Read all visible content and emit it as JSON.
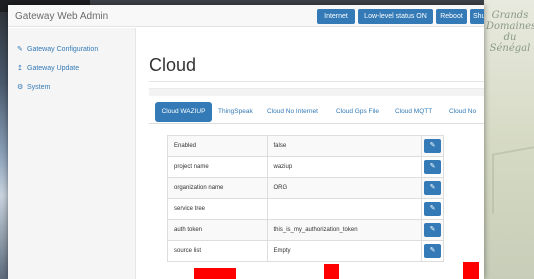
{
  "app": {
    "brand": "Gateway Web Admin"
  },
  "header_buttons": {
    "internet": "Internet",
    "lowlevel": "Low-level status ON",
    "reboot": "Reboot",
    "shutdown": "Shut"
  },
  "sidebar": {
    "items": [
      {
        "label": "Gateway Configuration",
        "icon": "edit-icon"
      },
      {
        "label": "Gateway Update",
        "icon": "upload-icon"
      },
      {
        "label": "System",
        "icon": "cogs-icon"
      }
    ]
  },
  "page": {
    "title": "Cloud"
  },
  "tabs": [
    {
      "label": "Cloud WAZIUP",
      "active": true
    },
    {
      "label": "ThingSpeak",
      "active": false
    },
    {
      "label": "Cloud No Internet",
      "active": false
    },
    {
      "label": "Cloud Gps File",
      "active": false
    },
    {
      "label": "Cloud MQTT",
      "active": false
    },
    {
      "label": "Cloud No",
      "active": false
    }
  ],
  "table": {
    "rows": [
      {
        "key": "Enabled",
        "value": "false"
      },
      {
        "key": "project name",
        "value": "waziup"
      },
      {
        "key": "organization name",
        "value": "ORG"
      },
      {
        "key": "service tree",
        "value": ""
      },
      {
        "key": "auth token",
        "value": "this_is_my_authorization_token"
      },
      {
        "key": "source list",
        "value": "Empty"
      }
    ],
    "edit_icon": "edit-icon"
  },
  "background": {
    "right_text": "Grands Domaines du Sénégal"
  },
  "colors": {
    "primary": "#337ab7",
    "annotation_red": "#ff0000"
  }
}
